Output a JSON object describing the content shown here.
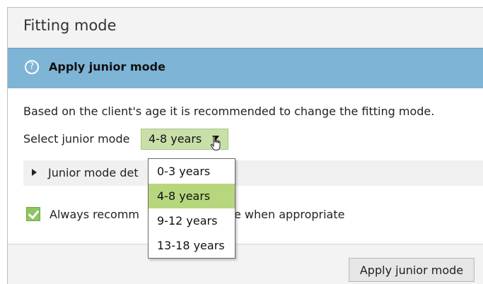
{
  "dialog": {
    "title": "Fitting mode",
    "banner": {
      "icon": "help-circle-icon",
      "text": "Apply junior mode"
    },
    "description": "Based on the client's age it is recommended to change the fitting mode.",
    "select": {
      "label": "Select junior mode",
      "value": "4-8 years",
      "options": [
        {
          "label": "0-3 years",
          "selected": false
        },
        {
          "label": "4-8 years",
          "selected": true
        },
        {
          "label": "9-12 years",
          "selected": false
        },
        {
          "label": "13-18 years",
          "selected": false
        }
      ]
    },
    "details": {
      "label": "Junior mode det"
    },
    "checkbox": {
      "label": "Always recomm",
      "label_tail": "e when appropriate",
      "checked": true
    },
    "apply_button": "Apply junior mode"
  },
  "colors": {
    "banner": "#7eb4d6",
    "select_fill": "#c9dfa8",
    "option_selected": "#b7d77e",
    "checkbox_fill": "#8cc660"
  }
}
